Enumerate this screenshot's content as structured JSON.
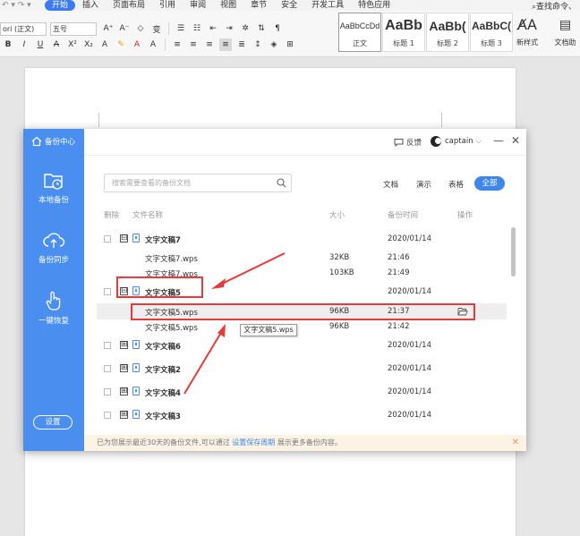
{
  "menubar": {
    "tabs": [
      "开始",
      "插入",
      "页面布局",
      "引用",
      "审阅",
      "视图",
      "章节",
      "安全",
      "开发工具",
      "特色应用"
    ],
    "active_tab": "开始",
    "search_label": "查找命令、"
  },
  "ribbon": {
    "font_name": "ori (正文)",
    "font_size": "五号",
    "styles": [
      {
        "preview": "AaBbCcDd",
        "name": "正文"
      },
      {
        "preview": "AaBb",
        "name": "标题 1"
      },
      {
        "preview": "AaBb(",
        "name": "标题 2"
      },
      {
        "preview": "AaBbC(",
        "name": "标题 3"
      }
    ],
    "new_style_label": "新样式",
    "doc_assist_label": "文档助"
  },
  "dialog": {
    "title": "备份中心",
    "nav": [
      {
        "label": "本地备份",
        "icon": "folder-clock-icon"
      },
      {
        "label": "备份同步",
        "icon": "cloud-upload-icon"
      },
      {
        "label": "一键恢复",
        "icon": "hand-click-icon"
      }
    ],
    "settings_label": "设置",
    "feedback_label": "反馈",
    "username": "captain",
    "search_placeholder": "搜索需要查看的备份文档",
    "filter_tabs": [
      "文档",
      "演示",
      "表格",
      "全部"
    ],
    "columns": [
      "删除",
      "文件名称",
      "大小",
      "备份时间",
      "操作"
    ],
    "rows": [
      {
        "type": "group",
        "name": "文字文稿7",
        "toggle": "⊟",
        "size": "",
        "time": "2020/01/14"
      },
      {
        "type": "file",
        "name": "文字文稿7.wps",
        "size": "32KB",
        "time": "21:46"
      },
      {
        "type": "file",
        "name": "文字文稿7.wps",
        "size": "103KB",
        "time": "21:49"
      },
      {
        "type": "group",
        "name": "文字文稿5",
        "toggle": "⊟",
        "size": "",
        "time": "2020/01/14"
      },
      {
        "type": "file",
        "name": "文字文稿5.wps",
        "size": "96KB",
        "time": "21:37",
        "highlight": true
      },
      {
        "type": "file",
        "name": "文字文稿5.wps",
        "size": "96KB",
        "time": "21:42"
      },
      {
        "type": "group",
        "name": "文字文稿6",
        "toggle": "⊞",
        "size": "",
        "time": "2020/01/14"
      },
      {
        "type": "group",
        "name": "文字文稿2",
        "toggle": "⊞",
        "size": "",
        "time": "2020/01/14"
      },
      {
        "type": "group",
        "name": "文字文稿4",
        "toggle": "⊞",
        "size": "",
        "time": "2020/01/14"
      },
      {
        "type": "group",
        "name": "文字文稿3",
        "toggle": "⊞",
        "size": "",
        "time": "2020/01/14"
      }
    ],
    "tooltip": "文字文稿5.wps",
    "footer_text": "已为您展示最近30天的备份文件,可以通过",
    "footer_link": "设置保存周期",
    "footer_tail": "展示更多备份内容。"
  },
  "colors": {
    "accent": "#3c7bef",
    "sidebar": "#4a8ff0",
    "annotation": "#e83a3a"
  }
}
